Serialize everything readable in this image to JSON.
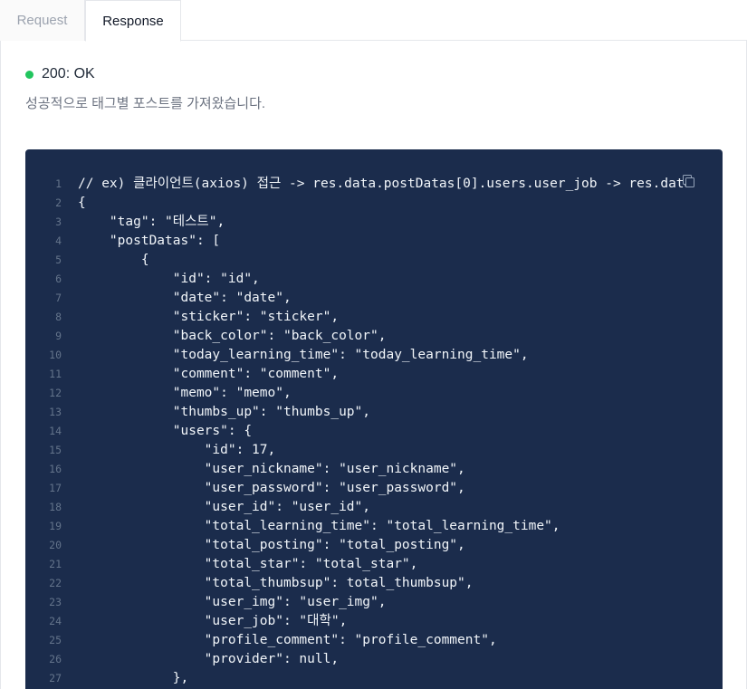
{
  "tabs": {
    "request_label": "Request",
    "response_label": "Response"
  },
  "status": {
    "text": "200: OK",
    "color": "#22c55e"
  },
  "description": "성공적으로 태그별 포스트를 가져왔습니다.",
  "code": {
    "lines": [
      "// ex) 클라이언트(axios) 접근 -> res.data.postDatas[0].users.user_job -> res.data",
      "{",
      "    \"tag\": \"테스트\",",
      "    \"postDatas\": [",
      "        {",
      "            \"id\": \"id\",",
      "            \"date\": \"date\",",
      "            \"sticker\": \"sticker\",",
      "            \"back_color\": \"back_color\",",
      "            \"today_learning_time\": \"today_learning_time\",",
      "            \"comment\": \"comment\",",
      "            \"memo\": \"memo\",",
      "            \"thumbs_up\": \"thumbs_up\",",
      "            \"users\": {",
      "                \"id\": 17,",
      "                \"user_nickname\": \"user_nickname\",",
      "                \"user_password\": \"user_password\",",
      "                \"user_id\": \"user_id\",",
      "                \"total_learning_time\": \"total_learning_time\",",
      "                \"total_posting\": \"total_posting\",",
      "                \"total_star\": \"total_star\",",
      "                \"total_thumbsup\": total_thumbsup\",",
      "                \"user_img\": \"user_img\",",
      "                \"user_job\": \"대학\",",
      "                \"profile_comment\": \"profile_comment\",",
      "                \"provider\": null,",
      "            },"
    ],
    "line_numbers": [
      "1",
      "2",
      "3",
      "4",
      "5",
      "6",
      "7",
      "8",
      "9",
      "10",
      "11",
      "12",
      "13",
      "14",
      "15",
      "16",
      "17",
      "18",
      "19",
      "20",
      "21",
      "22",
      "23",
      "24",
      "25",
      "26",
      "27"
    ]
  },
  "icons": {
    "copy": "copy-icon"
  }
}
